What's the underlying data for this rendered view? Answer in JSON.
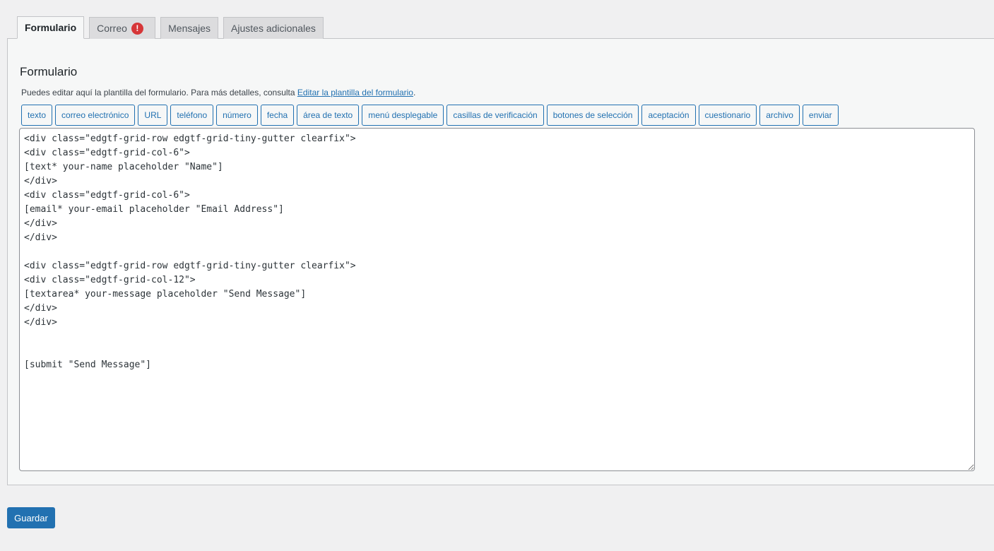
{
  "tabs": [
    {
      "label": "Formulario",
      "active": true
    },
    {
      "label": "Correo",
      "active": false,
      "badge": "!"
    },
    {
      "label": "Mensajes",
      "active": false
    },
    {
      "label": "Ajustes adicionales",
      "active": false
    }
  ],
  "panel": {
    "title": "Formulario",
    "description": "Puedes editar aquí la plantilla del formulario. Para más detalles, consulta ",
    "link_text": "Editar la plantilla del formulario",
    "description_end": "."
  },
  "tag_buttons": [
    "texto",
    "correo electrónico",
    "URL",
    "teléfono",
    "número",
    "fecha",
    "área de texto",
    "menú desplegable",
    "casillas de verificación",
    "botones de selección",
    "aceptación",
    "cuestionario",
    "archivo",
    "enviar"
  ],
  "form_template": "<div class=\"edgtf-grid-row edgtf-grid-tiny-gutter clearfix\">\n<div class=\"edgtf-grid-col-6\">\n[text* your-name placeholder \"Name\"]\n</div>\n<div class=\"edgtf-grid-col-6\">\n[email* your-email placeholder \"Email Address\"]\n</div>\n</div>\n\n<div class=\"edgtf-grid-row edgtf-grid-tiny-gutter clearfix\">\n<div class=\"edgtf-grid-col-12\">\n[textarea* your-message placeholder \"Send Message\"]\n</div>\n</div>\n\n\n[submit \"Send Message\"]",
  "save_label": "Guardar",
  "colors": {
    "accent": "#2271b1",
    "badge": "#d63638",
    "background": "#f0f0f1"
  },
  "icons": {
    "tab_badge": "warning-icon"
  }
}
